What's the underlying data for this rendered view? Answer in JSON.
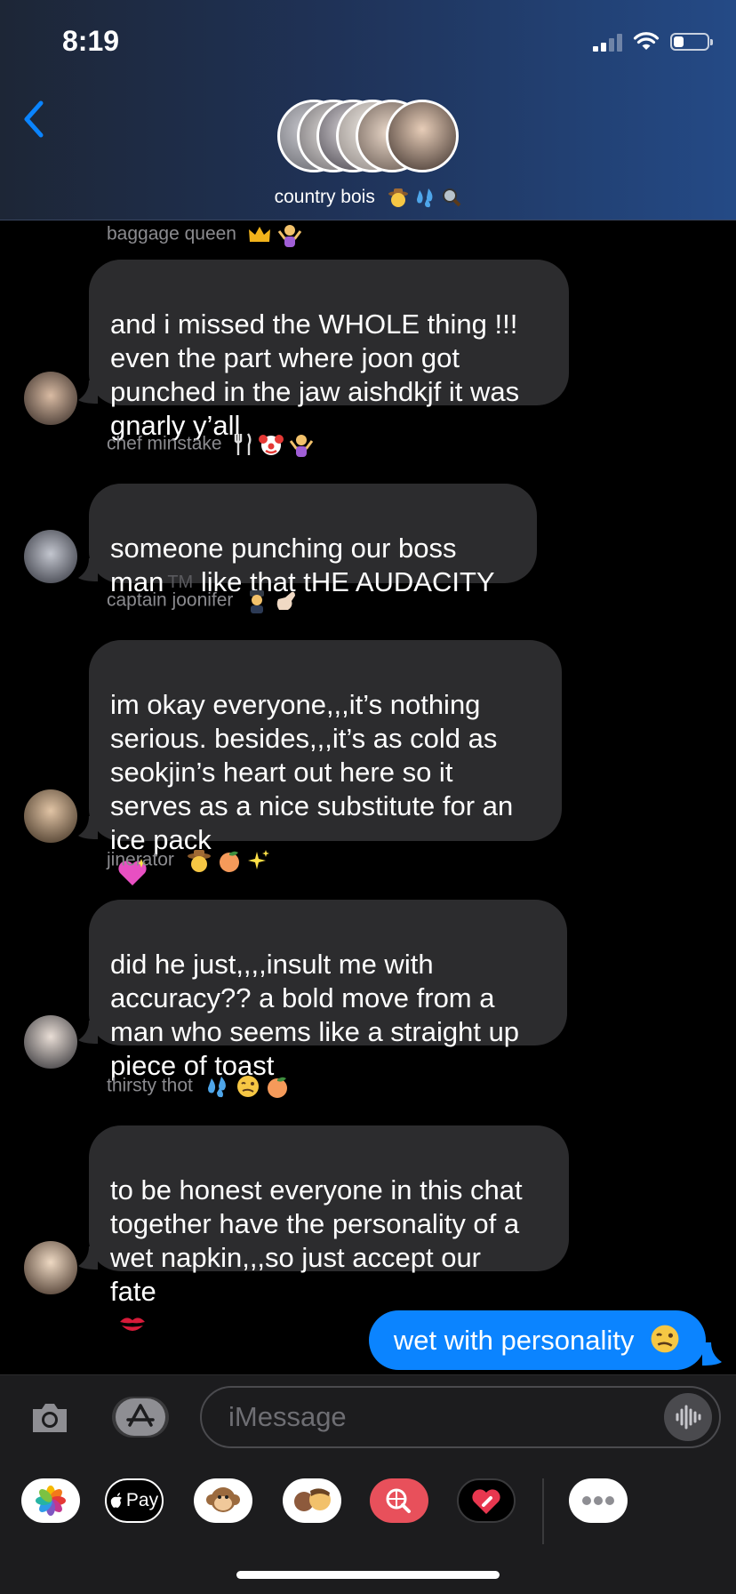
{
  "status_bar": {
    "time": "8:19"
  },
  "header": {
    "group_name": "country bois"
  },
  "messages": [
    {
      "sender": "baggage queen",
      "text": "and i missed the WHOLE thing !!!\neven the part where joon got\npunched in the jaw aishdkjf it was\ngnarly y’all"
    },
    {
      "sender": "chef minstake",
      "text_before": "someone punching our boss\nman",
      "tm": "TM",
      "text_after": "  like that tHE AUDACITY"
    },
    {
      "sender": "captain joonifer",
      "text": "im okay everyone,,,it’s nothing\nserious. besides,,,it’s as cold as\nseokjin’s heart out here so it\nserves as a nice substitute for an\nice pack"
    },
    {
      "sender": "jinerator",
      "text": "did he just,,,,insult me with\naccuracy?? a bold move from a\nman who seems like a straight up\npiece of toast"
    },
    {
      "sender": "thirsty thot",
      "text": "to be honest everyone in this chat\ntogether have the personality of a\nwet napkin,,,so just accept our\nfate"
    }
  ],
  "sent_message": {
    "text": "wet with personality"
  },
  "composer": {
    "placeholder": "iMessage"
  },
  "app_drawer": {
    "apple_pay_label": "Pay"
  },
  "colors": {
    "sent_bubble": "#0b84ff",
    "received_bubble": "#2c2c2e",
    "header_accent": "#244a86"
  }
}
